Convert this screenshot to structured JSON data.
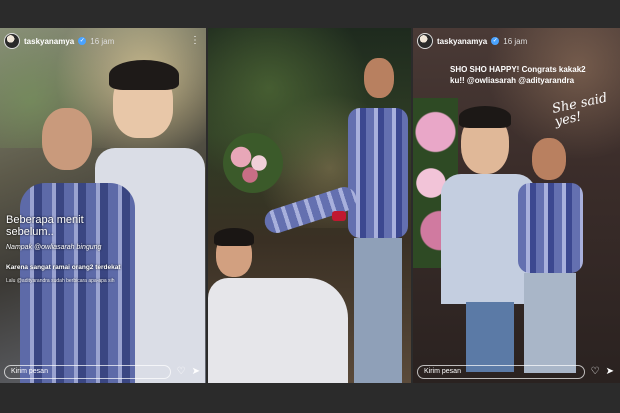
{
  "stories": [
    {
      "username": "taskyanamya",
      "time": "16 jam",
      "caption_main": "Beberapa menit sebelum..",
      "caption_mention": "Nampak @owliasarah bingung",
      "caption_bold": "Karena sangat ramai orang2 terdekat",
      "caption_small": "Lalu @adityarandra sudah berbicara apa-apa sih",
      "reply_placeholder": "Kirim pesan"
    },
    {
      "username": "",
      "time": "",
      "reply_placeholder": ""
    },
    {
      "username": "taskyanamya",
      "time": "16 jam",
      "caption_line1": "SHO SHO HAPPY! Congrats kakak2",
      "caption_line2": "ku!! @owliasarah @adityarandra",
      "script_text": "She said yes!",
      "reply_placeholder": "Kirim pesan"
    }
  ],
  "icons": {
    "heart": "heart-icon",
    "send": "send-icon",
    "more": "more-icon",
    "verified": "verified-icon"
  }
}
